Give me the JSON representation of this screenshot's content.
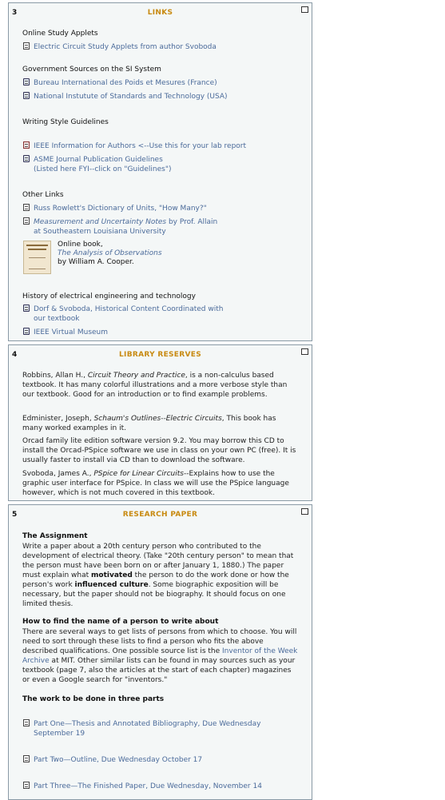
{
  "s3": {
    "num": "3",
    "title": "LINKS",
    "g1": "Online Study Applets",
    "l1": "Electric Circuit Study Applets from author Svoboda",
    "g2": "Government Sources on the SI System",
    "l2": "Bureau International des Poids et Mesures (France)",
    "l3": "National Instutute of Standards and Technology (USA)",
    "g3": "Writing Style Guidelines",
    "l4": "IEEE Information for Authors <--Use this for your lab report",
    "l5a": "ASME Journal Publication Guidelines",
    "l5b": "(Listed here FYI--click on \"Guidelines\")",
    "g4": "Other Links",
    "l6": "Russ Rowlett's Dictionary of Units, \"How Many?\"",
    "l7a": "Measurement and Uncertainty Notes",
    "l7b": " by Prof. Allain",
    "l7c": "at Southeastern Louisiana University",
    "book1": "Online book,",
    "book2": "The Analysis of Observations",
    "book3": "by William A. Cooper.",
    "g5": "History of electrical engineering and technology",
    "l8a": "Dorf & Svoboda, Historical Content Coordinated with",
    "l8b": "our textbook",
    "l9": "IEEE Virtual Museum"
  },
  "s4": {
    "num": "4",
    "title": "LIBRARY RESERVES",
    "p1_a": "Robbins, Allan H., ",
    "p1_i": "Circuit Theory and Practice",
    "p1_b": ", is a non-calculus based textbook.  It has many colorful illustrations and a more verbose style than our textbook.  Good for an introduction or to find example problems.",
    "p2_a": "Edminister, Joseph, ",
    "p2_i": "Schaum's Outlines--Electric Circuits",
    "p2_b": ", This book has many worked examples in it.",
    "p3": "Orcad family lite edition software version 9.2.  You may borrow this CD to install the Orcad-PSpice software we use in class on your own PC (free).  It is usually faster to install via CD than to download the software.",
    "p4_a": "Svoboda, James A., ",
    "p4_i": "PSpice for Linear Circuits",
    "p4_b": "--Explains how to use the graphic user interface for PSpice.  In class we will use the PSpice language however, which is not much covered in this textbook."
  },
  "s5": {
    "num": "5",
    "title": "RESEARCH PAPER",
    "h1": "The Assignment",
    "p1_a": "Write a paper about a 20th century person who contributed to the development of electrical theory. (Take \"20th century person\" to mean that the person must have been born on or after January 1, 1880.) The paper must explain what ",
    "p1_b1": "motivated",
    "p1_c": " the person to do the work done or how the person's work ",
    "p1_b2": "influenced culture",
    "p1_d": ". Some biographic exposition will be necessary, but the paper should not be biography. It should focus on one limited thesis.",
    "h2": "How to find the name of a person to write about",
    "p2_a": "There are several ways to get lists of persons from which to choose. You will need to sort through these lists to find a person who fits the above described qualifications. One possible source list is the ",
    "p2_link": "Inventor of the Week Archive",
    "p2_b": " at MIT. Other similar lists can be found in may sources such as your textbook (page 7, also the articles at the start of each chapter) magazines or even a Google search for \"inventors.\"",
    "h3": "The work to be done in three parts",
    "l1": "Part One—Thesis and Annotated Bibliography, Due Wednesday September 19",
    "l2": "Part Two—Outline, Due Wednesday October 17",
    "l3": "Part Three—The Finished Paper, Due Wednesday, November 14"
  }
}
